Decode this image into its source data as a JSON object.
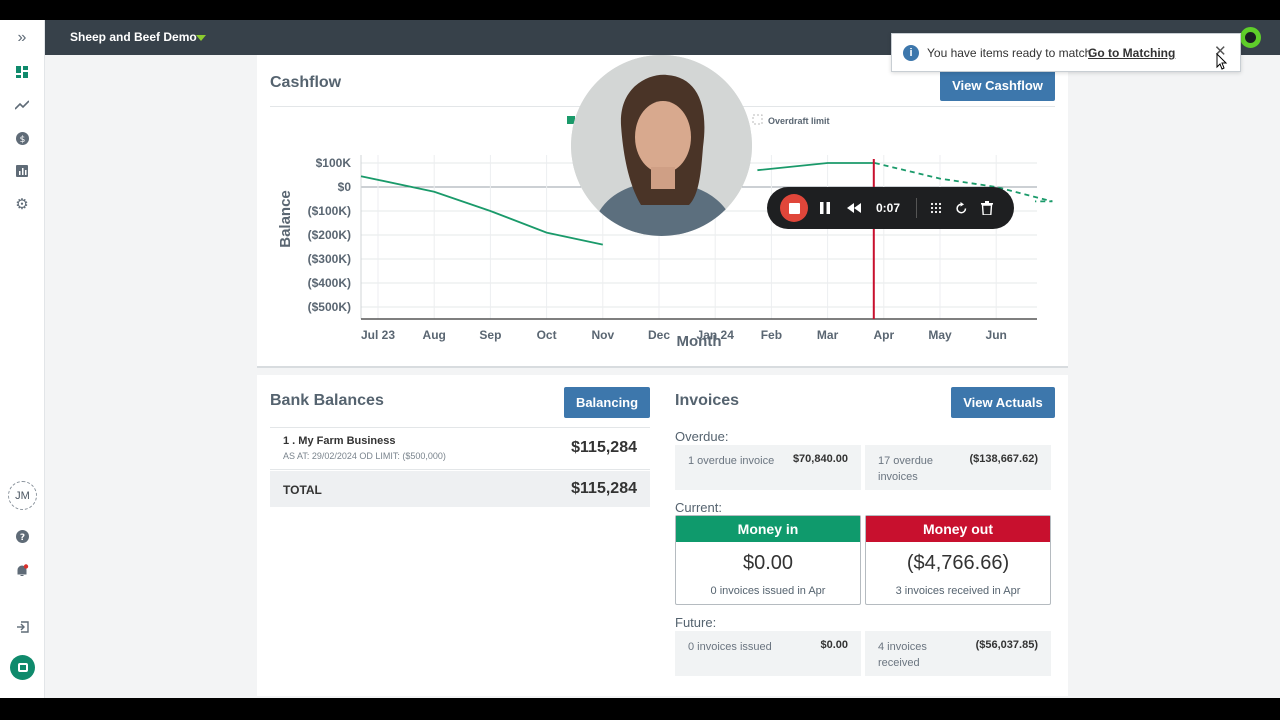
{
  "topbar": {
    "farm_name": "Sheep and Beef Demo"
  },
  "rail": {
    "avatar_initials": "JM"
  },
  "toast": {
    "message": "You have items ready to match.",
    "link": "Go to Matching",
    "info_glyph": "i",
    "close_glyph": "✕"
  },
  "recorder": {
    "time": "0:07"
  },
  "cashflow": {
    "title": "Cashflow",
    "button": "View Cashflow",
    "legend": {
      "limit_label": "Overdraft limit"
    }
  },
  "chart_data": {
    "type": "line",
    "xlabel": "Month",
    "ylabel": "Balance",
    "categories": [
      "Jul 23",
      "Aug",
      "Sep",
      "Oct",
      "Nov",
      "Dec",
      "Jan 24",
      "Feb",
      "Mar",
      "Apr",
      "May",
      "Jun"
    ],
    "y_ticks": [
      "$100K",
      "$0",
      "($100K)",
      "($200K)",
      "($300K)",
      "($400K)",
      "($500K)"
    ],
    "ylim": [
      -550000,
      110000
    ],
    "series": [
      {
        "style": "actual",
        "values": [
          45000,
          -20000,
          -100000,
          -190000,
          -240000,
          null,
          null,
          null,
          100000,
          100000
        ]
      },
      {
        "style": "forecast",
        "values": [
          null,
          null,
          null,
          null,
          null,
          null,
          null,
          null,
          null,
          100000,
          35000,
          0,
          -60000
        ]
      }
    ],
    "today_marker": "Apr",
    "grid": true
  },
  "bank": {
    "title": "Bank Balances",
    "button": "Balancing",
    "account": {
      "name": "1 . My Farm Business",
      "meta": "AS AT: 29/02/2024   OD LIMIT: ($500,000)",
      "amount": "$115,284"
    },
    "total": {
      "label": "TOTAL",
      "amount": "$115,284"
    }
  },
  "invoices": {
    "title": "Invoices",
    "button": "View Actuals",
    "overdue_label": "Overdue:",
    "overdue_in": {
      "label": "1 overdue invoice",
      "amount": "$70,840.00"
    },
    "overdue_out": {
      "label": "17 overdue invoices",
      "amount": "($138,667.62)"
    },
    "current_label": "Current:",
    "money_in": {
      "title": "Money in",
      "amount": "$0.00",
      "sub": "0 invoices issued in Apr"
    },
    "money_out": {
      "title": "Money out",
      "amount": "($4,766.66)",
      "sub": "3 invoices received in Apr"
    },
    "future_label": "Future:",
    "future_in": {
      "label": "0 invoices issued",
      "amount": "$0.00"
    },
    "future_out": {
      "label": "4 invoices received",
      "amount": "($56,037.85)"
    }
  },
  "colors": {
    "topbar": "#37414a",
    "accent": "#3d77ac",
    "money_in": "#0f9a6c",
    "money_out": "#c8102e",
    "series": "#1a9a6a",
    "today": "#c8102e"
  }
}
